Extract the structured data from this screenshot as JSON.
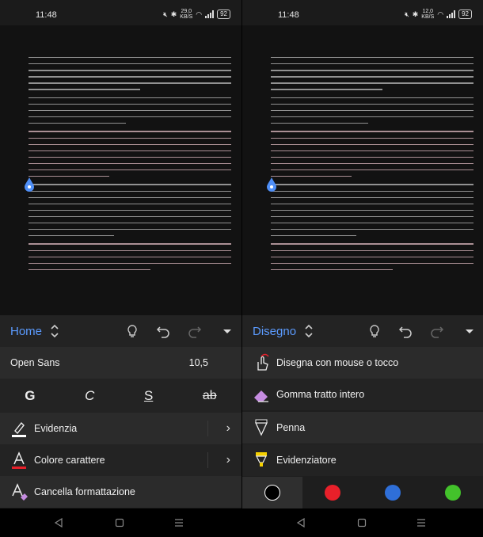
{
  "left": {
    "status": {
      "time": "11:48",
      "speed_value": "29,0",
      "speed_unit": "KB/S",
      "battery": "92"
    },
    "toolbar": {
      "mode": "Home"
    },
    "font": {
      "name": "Open Sans",
      "size": "10,5"
    },
    "format_buttons": {
      "bold": "G",
      "italic": "C",
      "underline": "S",
      "strike": "ab"
    },
    "menu": [
      {
        "label": "Evidenzia",
        "icon": "highlighter-pen-icon"
      },
      {
        "label": "Colore carattere",
        "icon": "font-color-icon"
      },
      {
        "label": "Cancella formattazione",
        "icon": "clear-formatting-icon"
      }
    ]
  },
  "right": {
    "status": {
      "time": "11:48",
      "speed_value": "12,0",
      "speed_unit": "KB/S",
      "battery": "92"
    },
    "toolbar": {
      "mode": "Disegno"
    },
    "menu": [
      {
        "label": "Disegna con mouse o tocco",
        "icon": "touch-draw-icon"
      },
      {
        "label": "Gomma tratto intero",
        "icon": "eraser-icon"
      },
      {
        "label": "Penna",
        "icon": "pen-icon"
      },
      {
        "label": "Evidenziatore",
        "icon": "highlighter-icon"
      }
    ],
    "colors": [
      {
        "name": "black",
        "hex": "#000000"
      },
      {
        "name": "red",
        "hex": "#e8202a"
      },
      {
        "name": "blue",
        "hex": "#2f6fd8"
      },
      {
        "name": "green",
        "hex": "#43c22b"
      }
    ]
  },
  "theme": {
    "accent": "#5b9bff",
    "background": "#1e1e1e"
  }
}
